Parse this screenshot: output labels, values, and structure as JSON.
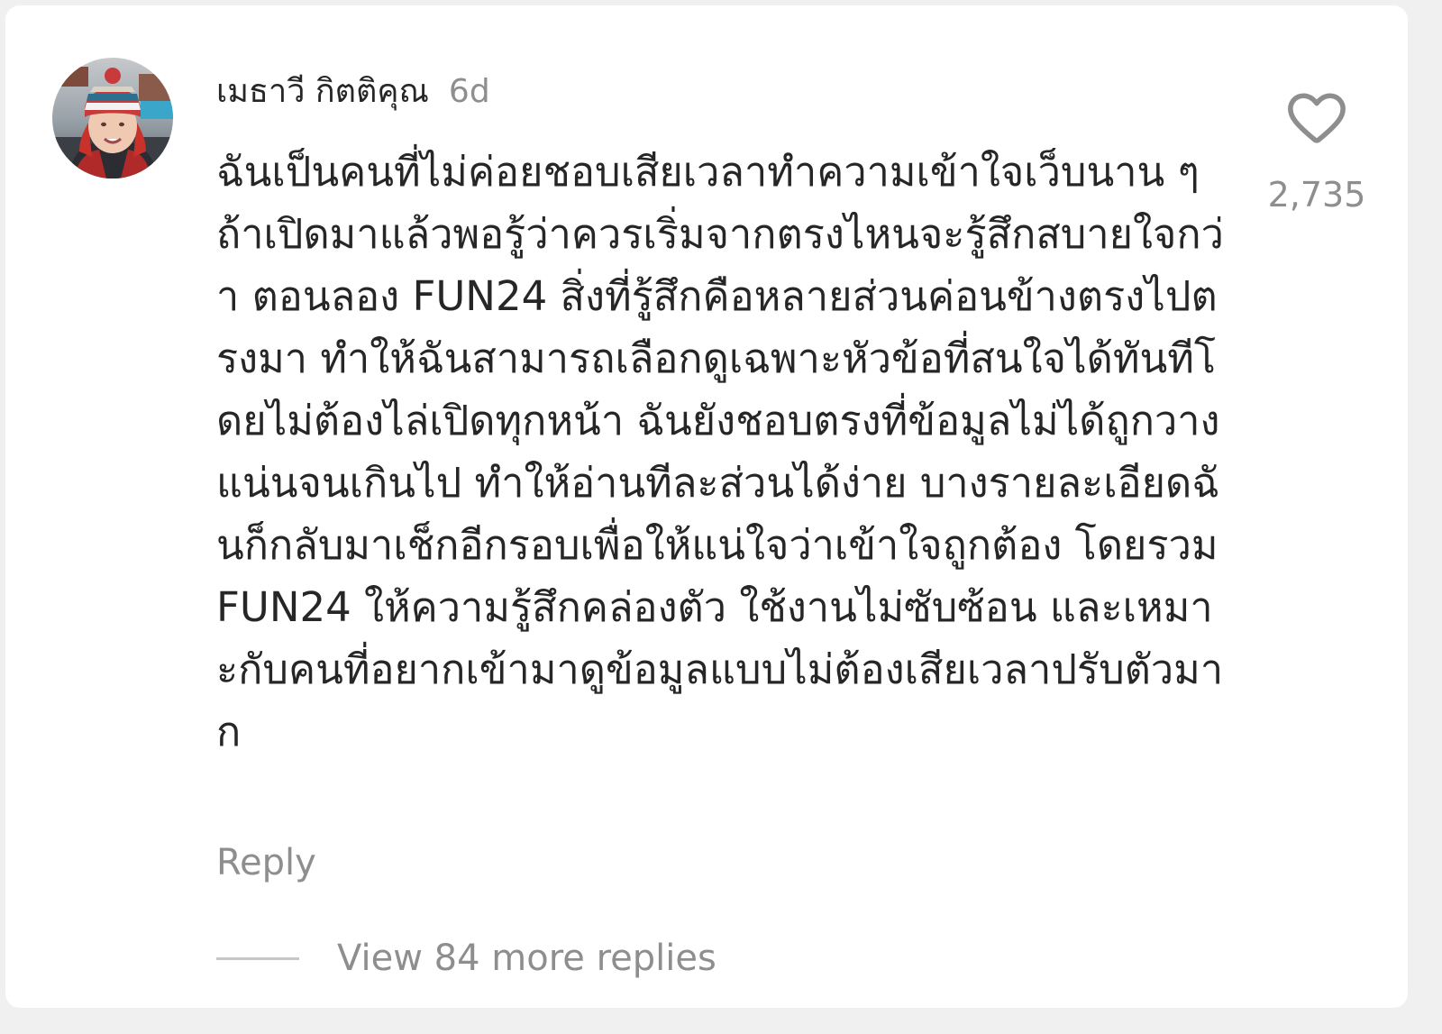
{
  "comment": {
    "username": "เมธาวี กิตติคุณ",
    "time": "6d",
    "text": "ฉันเป็นคนที่ไม่ค่อยชอบเสียเวลาทำความเข้าใจเว็บนาน ๆ ถ้าเปิดมาแล้วพอรู้ว่าควรเริ่มจากตรงไหนจะรู้สึกสบายใจกว่า ตอนลอง FUN24 สิ่งที่รู้สึกคือหลายส่วนค่อนข้างตรงไปตรงมา ทำให้ฉันสามารถเลือกดูเฉพาะหัวข้อที่สนใจได้ทันทีโดยไม่ต้องไล่เปิดทุกหน้า ฉันยังชอบตรงที่ข้อมูลไม่ได้ถูกวางแน่นจนเกินไป ทำให้อ่านทีละส่วนได้ง่าย บางรายละเอียดฉันก็กลับมาเช็กอีกรอบเพื่อให้แน่ใจว่าเข้าใจถูกต้อง โดยรวม FUN24 ให้ความรู้สึกคล่องตัว ใช้งานไม่ซับซ้อน และเหมาะกับคนที่อยากเข้ามาดูข้อมูลแบบไม่ต้องเสียเวลาปรับตัวมาก",
    "like_count": "2,735",
    "reply_label": "Reply",
    "view_replies_label": "View 84 more replies",
    "like_icon": "heart-outline-icon"
  },
  "colors": {
    "text_primary": "#262626",
    "text_secondary": "#8e8e8e",
    "background": "#ffffff",
    "page_background": "#f0f0f0"
  }
}
